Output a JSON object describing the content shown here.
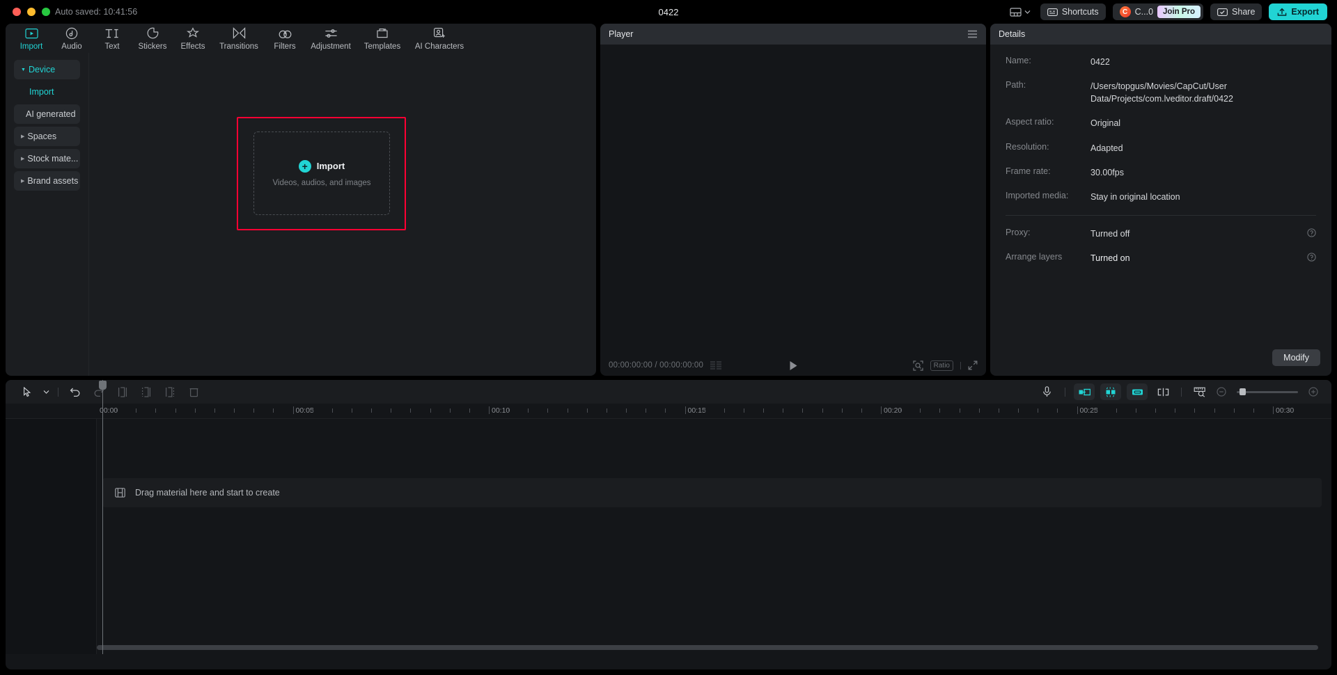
{
  "titlebar": {
    "autosave": "Auto saved: 10:41:56",
    "project_title": "0422",
    "layout_icon": "panel-layout-icon",
    "chevron_icon": "chevron-down-icon",
    "shortcuts_label": "Shortcuts",
    "shortcuts_icon": "keyboard-icon",
    "account_initial": "C",
    "account_label": "C...0",
    "join_pro_label": "Join Pro",
    "share_label": "Share",
    "share_icon": "share-icon",
    "export_label": "Export",
    "export_icon": "export-upload-icon",
    "accent_color": "#21d4d4"
  },
  "nav": {
    "items": [
      {
        "label": "Import",
        "icon": "import-media-icon",
        "active": true
      },
      {
        "label": "Audio",
        "icon": "audio-note-icon",
        "active": false
      },
      {
        "label": "Text",
        "icon": "text-ti-icon",
        "active": false
      },
      {
        "label": "Stickers",
        "icon": "sticker-icon",
        "active": false
      },
      {
        "label": "Effects",
        "icon": "effects-star-icon",
        "active": false
      },
      {
        "label": "Transitions",
        "icon": "transitions-icon",
        "active": false
      },
      {
        "label": "Filters",
        "icon": "filters-icon",
        "active": false
      },
      {
        "label": "Adjustment",
        "icon": "adjustment-sliders-icon",
        "active": false
      },
      {
        "label": "Templates",
        "icon": "templates-icon",
        "active": false
      },
      {
        "label": "AI Characters",
        "icon": "ai-characters-icon",
        "active": false
      }
    ]
  },
  "sidebar": {
    "items": [
      {
        "label": "Device",
        "expandable": true,
        "accent": true,
        "sub": false
      },
      {
        "label": "Import",
        "expandable": false,
        "accent": true,
        "sub": true
      },
      {
        "label": "AI generated",
        "expandable": false,
        "accent": false,
        "sub": false
      },
      {
        "label": "Spaces",
        "expandable": true,
        "accent": false,
        "sub": false
      },
      {
        "label": "Stock mate...",
        "expandable": true,
        "accent": false,
        "sub": false
      },
      {
        "label": "Brand assets",
        "expandable": true,
        "accent": false,
        "sub": false
      }
    ]
  },
  "dropzone": {
    "highlight_color": "#ff0033",
    "plus_icon": "plus-icon",
    "label": "Import",
    "sublabel": "Videos, audios, and images"
  },
  "player": {
    "title": "Player",
    "menu_icon": "hamburger-menu-icon",
    "current_time": "00:00:00:00",
    "time_separator": "/",
    "total_time": "00:00:00:00",
    "frames_icon": "frames-grid-icon",
    "play_icon": "play-icon",
    "zoom_fit_icon": "zoom-fit-icon",
    "ratio_label": "Ratio",
    "fullscreen_icon": "fullscreen-icon"
  },
  "details": {
    "title": "Details",
    "rows": [
      {
        "label": "Name:",
        "value": "0422",
        "help": false,
        "bright": false
      },
      {
        "label": "Path:",
        "value": "/Users/topgus/Movies/CapCut/User Data/Projects/com.lveditor.draft/0422",
        "help": false,
        "bright": false
      },
      {
        "label": "Aspect ratio:",
        "value": "Original",
        "help": false,
        "bright": false
      },
      {
        "label": "Resolution:",
        "value": "Adapted",
        "help": false,
        "bright": false
      },
      {
        "label": "Frame rate:",
        "value": "30.00fps",
        "help": false,
        "bright": false
      },
      {
        "label": "Imported media:",
        "value": "Stay in original location",
        "help": false,
        "bright": false
      }
    ],
    "rows_after_sep": [
      {
        "label": "Proxy:",
        "value": "Turned off",
        "help": true,
        "help_icon": "help-circle-icon",
        "bright": false
      },
      {
        "label": "Arrange layers",
        "value": "Turned on",
        "help": true,
        "help_icon": "help-circle-icon",
        "bright": true
      }
    ],
    "modify_label": "Modify"
  },
  "timeline": {
    "toolbar_left": [
      {
        "icon": "select-cursor-icon",
        "enabled": true
      },
      {
        "icon": "chevron-down-icon",
        "enabled": true
      },
      {
        "icon": "undo-icon",
        "enabled": true
      },
      {
        "icon": "redo-icon",
        "enabled": false
      },
      {
        "icon": "split-icon",
        "enabled": false
      },
      {
        "icon": "trim-left-icon",
        "enabled": false
      },
      {
        "icon": "trim-right-icon",
        "enabled": false
      },
      {
        "icon": "delete-icon",
        "enabled": false
      }
    ],
    "toolbar_right": [
      {
        "icon": "microphone-icon",
        "highlighted": false
      },
      {
        "icon": "mirror-left-icon",
        "highlighted": true
      },
      {
        "icon": "mirror-split-icon",
        "highlighted": true
      },
      {
        "icon": "mirror-right-icon",
        "highlighted": true
      },
      {
        "icon": "crop-split-icon",
        "highlighted": false
      },
      {
        "icon": "ruler-zoom-icon",
        "highlighted": false
      }
    ],
    "zoom_out_icon": "zoom-out-icon",
    "zoom_in_icon": "zoom-in-icon",
    "ruler_labels": [
      "00:00",
      "00:05",
      "00:10",
      "00:15",
      "00:20",
      "00:25",
      "00:30"
    ],
    "drop_hint_icon": "filmstrip-icon",
    "drop_hint_text": "Drag material here and start to create",
    "scrollbar_icon": "horizontal-scrollbar"
  }
}
